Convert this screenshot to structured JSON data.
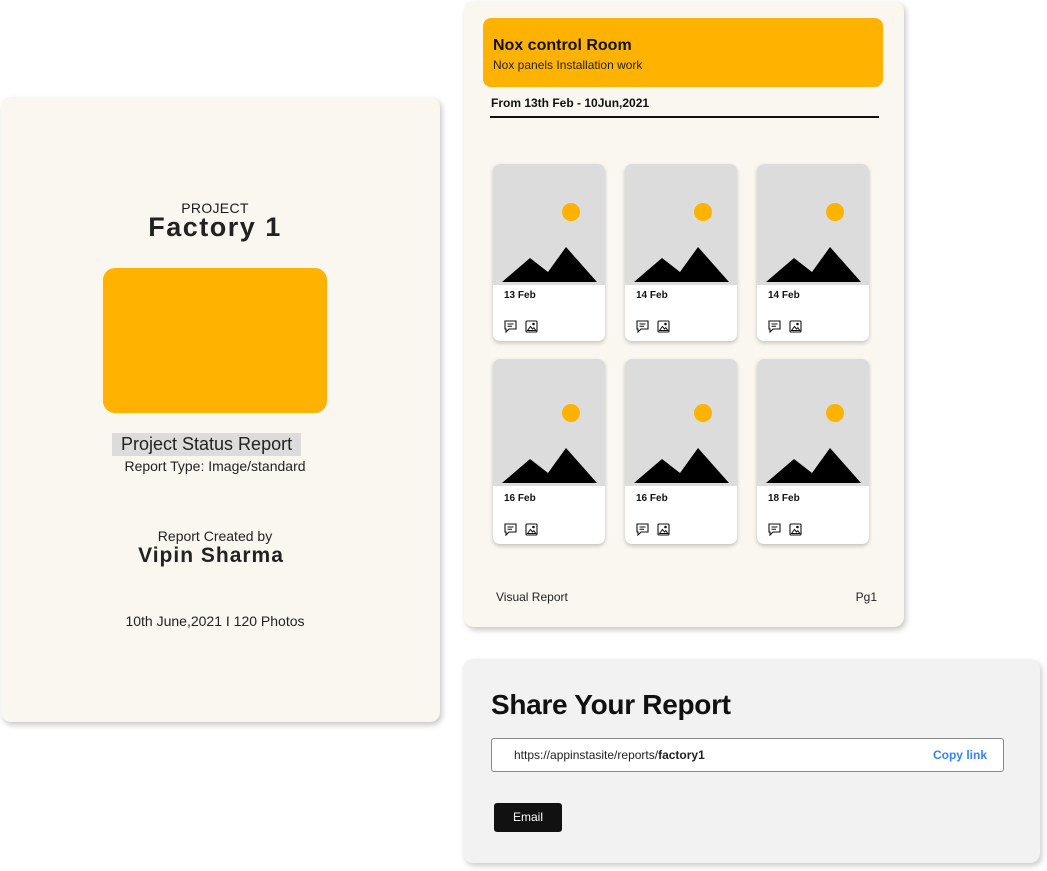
{
  "cover": {
    "label": "PROJECT",
    "name": "Factory 1",
    "status_title": "Project Status Report",
    "report_type": "Report Type: Image/standard",
    "created_label": "Report Created by",
    "creator": "Vipin Sharma",
    "meta": "10th June,2021 I 120 Photos",
    "thumb_color": "#ffb200"
  },
  "page": {
    "banner_title": "Nox control Room",
    "banner_subtitle": "Nox panels Installation work",
    "date_range": "From 13th Feb - 10Jun,2021",
    "photos": [
      {
        "date": "13 Feb",
        "icons": [
          "comment-icon",
          "image-icon"
        ]
      },
      {
        "date": "14 Feb",
        "icons": [
          "comment-icon",
          "image-icon"
        ]
      },
      {
        "date": "14 Feb",
        "icons": [
          "comment-icon",
          "image-icon"
        ]
      },
      {
        "date": "16 Feb",
        "icons": [
          "comment-icon",
          "image-icon"
        ]
      },
      {
        "date": "16 Feb",
        "icons": [
          "comment-icon",
          "image-icon"
        ]
      },
      {
        "date": "18 Feb",
        "icons": [
          "comment-icon",
          "image-icon"
        ]
      }
    ],
    "footer_left": "Visual Report",
    "footer_right": "Pg1",
    "accent": "#ffb200"
  },
  "share": {
    "title": "Share Your Report",
    "url_prefix": "https://appinstasite/reports/",
    "url_slug": "factory1",
    "copy_label": "Copy link",
    "email_label": "Email",
    "link_color": "#2f86ff"
  }
}
